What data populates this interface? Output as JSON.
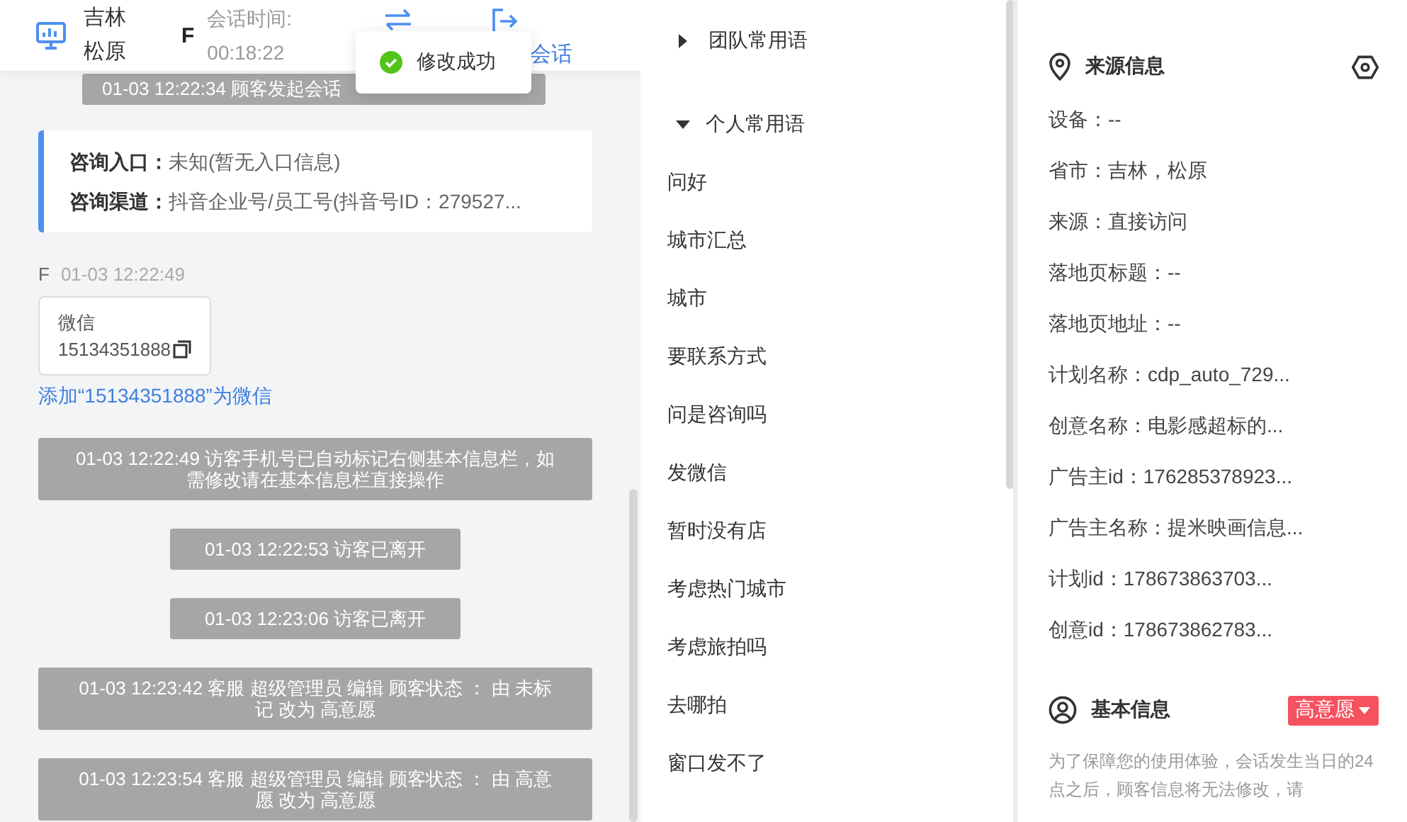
{
  "header": {
    "customer_name": "吉林松原",
    "gender": "F",
    "session_time_label": "会话时间:",
    "session_time": "00:18:22",
    "end_session_label": "会话"
  },
  "toast": {
    "kind": "success",
    "text": "修改成功"
  },
  "chat": [
    {
      "kind": "session_start",
      "text": "01-03 12:22:34 顾客发起会话"
    },
    {
      "kind": "info_card",
      "rows": [
        {
          "label": "咨询入口：",
          "value": "未知(暂无入口信息)"
        },
        {
          "label": "咨询渠道：",
          "value": "抖音企业号/员工号(抖音号ID：279527..."
        }
      ]
    },
    {
      "kind": "visitor_card",
      "sender": "F",
      "time": "01-03 12:22:49",
      "card_title": "微信",
      "card_value": "15134351888",
      "action_link": "添加“15134351888”为微信"
    },
    {
      "kind": "system",
      "text": "01-03 12:22:49 访客手机号已自动标记右侧基本信息栏，如需修改请在基本信息栏直接操作"
    },
    {
      "kind": "system",
      "text": "01-03 12:22:53 访客已离开"
    },
    {
      "kind": "system",
      "text": "01-03 12:23:06 访客已离开"
    },
    {
      "kind": "system",
      "text": "01-03 12:23:42 客服 超级管理员 编辑 顾客状态 ： 由 未标记 改为 高意愿"
    },
    {
      "kind": "system",
      "text": "01-03 12:23:54 客服 超级管理员 编辑 顾客状态 ： 由 高意愿 改为 高意愿"
    }
  ],
  "phrases": [
    {
      "title": "团队常用语",
      "expanded": false
    },
    {
      "title": "个人常用语",
      "expanded": true,
      "children": [
        {
          "label": "问好"
        },
        {
          "label": "城市汇总"
        },
        {
          "label": "城市"
        },
        {
          "label": "要联系方式"
        },
        {
          "label": "问是咨询吗"
        },
        {
          "label": "发微信"
        },
        {
          "label": "暂时没有店"
        },
        {
          "label": "考虑热门城市"
        },
        {
          "label": "考虑旅拍吗"
        },
        {
          "label": "去哪拍"
        },
        {
          "label": "窗口发不了"
        }
      ]
    }
  ],
  "source_info": {
    "title": "来源信息",
    "rows": [
      "设备：--",
      "省市：吉林，松原",
      "来源：直接访问",
      "落地页标题：--",
      "落地页地址：--",
      "计划名称：cdp_auto_729...",
      "创意名称：电影感超标的...",
      "广告主id：176285378923...",
      "广告主名称：提米映画信息...",
      "计划id：178673863703...",
      "创意id：178673862783..."
    ]
  },
  "basic_info": {
    "title": "基本信息",
    "status": "高意愿",
    "notice": "为了保障您的使用体验，会话发生当日的24点之后，顾客信息将无法修改，请"
  }
}
